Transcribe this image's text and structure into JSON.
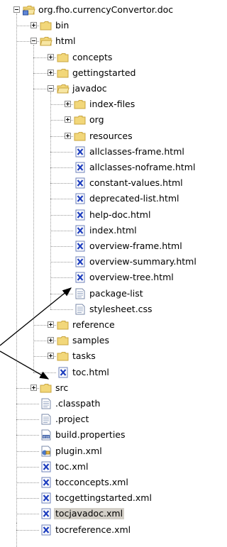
{
  "tree": [
    {
      "label": "org.fho.currencyConvertor.doc",
      "depth": 0,
      "expander": "minus",
      "icon": "project-folder-icon"
    },
    {
      "label": "bin",
      "depth": 1,
      "expander": "plus",
      "icon": "folder-icon"
    },
    {
      "label": "html",
      "depth": 1,
      "expander": "minus",
      "icon": "folder-open-icon"
    },
    {
      "label": "concepts",
      "depth": 2,
      "expander": "plus",
      "icon": "folder-icon"
    },
    {
      "label": "gettingstarted",
      "depth": 2,
      "expander": "plus",
      "icon": "folder-icon"
    },
    {
      "label": "javadoc",
      "depth": 2,
      "expander": "minus",
      "icon": "folder-open-icon"
    },
    {
      "label": "index-files",
      "depth": 3,
      "expander": "plus",
      "icon": "folder-icon"
    },
    {
      "label": "org",
      "depth": 3,
      "expander": "plus",
      "icon": "folder-icon"
    },
    {
      "label": "resources",
      "depth": 3,
      "expander": "plus",
      "icon": "folder-icon"
    },
    {
      "label": "allclasses-frame.html",
      "depth": 3,
      "expander": "none",
      "icon": "html-file-icon"
    },
    {
      "label": "allclasses-noframe.html",
      "depth": 3,
      "expander": "none",
      "icon": "html-file-icon"
    },
    {
      "label": "constant-values.html",
      "depth": 3,
      "expander": "none",
      "icon": "html-file-icon"
    },
    {
      "label": "deprecated-list.html",
      "depth": 3,
      "expander": "none",
      "icon": "html-file-icon"
    },
    {
      "label": "help-doc.html",
      "depth": 3,
      "expander": "none",
      "icon": "html-file-icon"
    },
    {
      "label": "index.html",
      "depth": 3,
      "expander": "none",
      "icon": "html-file-icon"
    },
    {
      "label": "overview-frame.html",
      "depth": 3,
      "expander": "none",
      "icon": "html-file-icon"
    },
    {
      "label": "overview-summary.html",
      "depth": 3,
      "expander": "none",
      "icon": "html-file-icon"
    },
    {
      "label": "overview-tree.html",
      "depth": 3,
      "expander": "none",
      "icon": "html-file-icon"
    },
    {
      "label": "package-list",
      "depth": 3,
      "expander": "none",
      "icon": "text-file-icon"
    },
    {
      "label": "stylesheet.css",
      "depth": 3,
      "expander": "none",
      "icon": "text-file-icon"
    },
    {
      "label": "reference",
      "depth": 2,
      "expander": "plus",
      "icon": "folder-icon"
    },
    {
      "label": "samples",
      "depth": 2,
      "expander": "plus",
      "icon": "folder-icon"
    },
    {
      "label": "tasks",
      "depth": 2,
      "expander": "plus",
      "icon": "folder-icon"
    },
    {
      "label": "toc.html",
      "depth": 2,
      "expander": "none",
      "icon": "html-file-icon"
    },
    {
      "label": "src",
      "depth": 1,
      "expander": "plus",
      "icon": "folder-icon"
    },
    {
      "label": ".classpath",
      "depth": 1,
      "expander": "none",
      "icon": "text-file-icon"
    },
    {
      "label": ".project",
      "depth": 1,
      "expander": "none",
      "icon": "text-file-icon"
    },
    {
      "label": "build.properties",
      "depth": 1,
      "expander": "none",
      "icon": "properties-file-icon"
    },
    {
      "label": "plugin.xml",
      "depth": 1,
      "expander": "none",
      "icon": "plugin-file-icon"
    },
    {
      "label": "toc.xml",
      "depth": 1,
      "expander": "none",
      "icon": "xml-file-icon"
    },
    {
      "label": "tocconcepts.xml",
      "depth": 1,
      "expander": "none",
      "icon": "xml-file-icon"
    },
    {
      "label": "tocgettingstarted.xml",
      "depth": 1,
      "expander": "none",
      "icon": "xml-file-icon"
    },
    {
      "label": "tocjavadoc.xml",
      "depth": 1,
      "expander": "none",
      "icon": "xml-file-icon",
      "selected": true
    },
    {
      "label": "tocreference.xml",
      "depth": 1,
      "expander": "none",
      "icon": "xml-file-icon"
    }
  ],
  "colors": {
    "folder": "#f2d77a",
    "folder_dark": "#c9a53f",
    "html_blue": "#1f3fbf",
    "selection": "#d4d0c8"
  }
}
